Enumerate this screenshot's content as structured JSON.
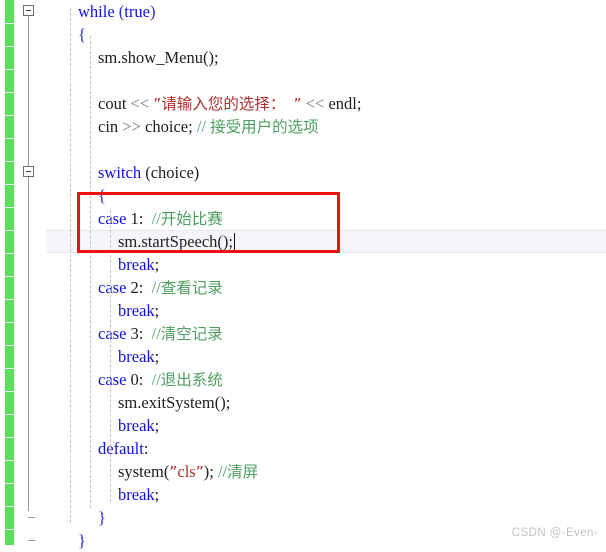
{
  "app": {
    "kind": "code-editor",
    "language": "C++",
    "theme_background": "#ffffff"
  },
  "colors": {
    "keyword": "#1111dd",
    "string": "#b03030",
    "comment": "#4d9f60",
    "operator": "#6a7a8c",
    "plain": "#202020",
    "change_bar": "#5ae05a",
    "annotation_rect": "#ee1111",
    "current_line": "#f6f6fa",
    "watermark": "#c2c2c2"
  },
  "gutter": {
    "fold_markers": [
      {
        "label": "-",
        "line": 1
      },
      {
        "label": "-",
        "line": 8
      }
    ],
    "change_bar_label": "modified-lines-indicator"
  },
  "annotation": {
    "shape": "rectangle",
    "color": "#ee1111",
    "covers_lines": "case 1: //开始比赛  /  sm.startSpeech();"
  },
  "caret": {
    "line": 11,
    "after_text": "sm.startSpeech();"
  },
  "watermark": {
    "text": "CSDN @-Even-"
  },
  "code": {
    "lines": [
      {
        "n": 1,
        "indent": 1,
        "tokens": [
          {
            "t": "while",
            "c": "kw"
          },
          {
            "t": " ",
            "c": "pln"
          },
          {
            "t": "(",
            "c": "brc"
          },
          {
            "t": "true",
            "c": "kw"
          },
          {
            "t": ")",
            "c": "brc"
          }
        ]
      },
      {
        "n": 2,
        "indent": 1,
        "tokens": [
          {
            "t": "{",
            "c": "brc"
          }
        ]
      },
      {
        "n": 3,
        "indent": 2,
        "tokens": [
          {
            "t": "sm.show_Menu();",
            "c": "pln"
          }
        ]
      },
      {
        "n": 4,
        "indent": 0,
        "tokens": []
      },
      {
        "n": 5,
        "indent": 2,
        "tokens": [
          {
            "t": "cout ",
            "c": "pln"
          },
          {
            "t": "<<",
            "c": "op"
          },
          {
            "t": " ",
            "c": "pln"
          },
          {
            "t": "”请输入您的选择：  ”",
            "c": "str"
          },
          {
            "t": " ",
            "c": "pln"
          },
          {
            "t": "<<",
            "c": "op"
          },
          {
            "t": " endl;",
            "c": "pln"
          }
        ]
      },
      {
        "n": 6,
        "indent": 2,
        "tokens": [
          {
            "t": "cin ",
            "c": "pln"
          },
          {
            "t": ">>",
            "c": "op"
          },
          {
            "t": " choice; ",
            "c": "pln"
          },
          {
            "t": "// 接受用户的选项",
            "c": "cmt"
          }
        ]
      },
      {
        "n": 7,
        "indent": 0,
        "tokens": []
      },
      {
        "n": 8,
        "indent": 2,
        "tokens": [
          {
            "t": "switch",
            "c": "kw"
          },
          {
            "t": " ",
            "c": "pln"
          },
          {
            "t": "(choice)",
            "c": "pln"
          }
        ]
      },
      {
        "n": 9,
        "indent": 2,
        "tokens": [
          {
            "t": "{",
            "c": "brc"
          }
        ]
      },
      {
        "n": 10,
        "indent": 2,
        "tokens": [
          {
            "t": "case",
            "c": "kw"
          },
          {
            "t": " 1:  ",
            "c": "pln"
          },
          {
            "t": "//开始比赛",
            "c": "cmt"
          }
        ]
      },
      {
        "n": 11,
        "indent": 3,
        "tokens": [
          {
            "t": "sm.startSpeech();",
            "c": "pln"
          }
        ],
        "caret": true,
        "current": true
      },
      {
        "n": 12,
        "indent": 3,
        "tokens": [
          {
            "t": "break",
            "c": "kw"
          },
          {
            "t": ";",
            "c": "pln"
          }
        ]
      },
      {
        "n": 13,
        "indent": 2,
        "tokens": [
          {
            "t": "case",
            "c": "kw"
          },
          {
            "t": " 2:  ",
            "c": "pln"
          },
          {
            "t": "//查看记录",
            "c": "cmt"
          }
        ]
      },
      {
        "n": 14,
        "indent": 3,
        "tokens": [
          {
            "t": "break",
            "c": "kw"
          },
          {
            "t": ";",
            "c": "pln"
          }
        ]
      },
      {
        "n": 15,
        "indent": 2,
        "tokens": [
          {
            "t": "case",
            "c": "kw"
          },
          {
            "t": " 3:  ",
            "c": "pln"
          },
          {
            "t": "//清空记录",
            "c": "cmt"
          }
        ]
      },
      {
        "n": 16,
        "indent": 3,
        "tokens": [
          {
            "t": "break",
            "c": "kw"
          },
          {
            "t": ";",
            "c": "pln"
          }
        ]
      },
      {
        "n": 17,
        "indent": 2,
        "tokens": [
          {
            "t": "case",
            "c": "kw"
          },
          {
            "t": " 0:  ",
            "c": "pln"
          },
          {
            "t": "//退出系统",
            "c": "cmt"
          }
        ]
      },
      {
        "n": 18,
        "indent": 3,
        "tokens": [
          {
            "t": "sm.exitSystem();",
            "c": "pln"
          }
        ]
      },
      {
        "n": 19,
        "indent": 3,
        "tokens": [
          {
            "t": "break",
            "c": "kw"
          },
          {
            "t": ";",
            "c": "pln"
          }
        ]
      },
      {
        "n": 20,
        "indent": 2,
        "tokens": [
          {
            "t": "default",
            "c": "kw"
          },
          {
            "t": ":",
            "c": "pln"
          }
        ]
      },
      {
        "n": 21,
        "indent": 3,
        "tokens": [
          {
            "t": "system(",
            "c": "pln"
          },
          {
            "t": "”cls”",
            "c": "str"
          },
          {
            "t": "); ",
            "c": "pln"
          },
          {
            "t": "//清屏",
            "c": "cmt"
          }
        ]
      },
      {
        "n": 22,
        "indent": 3,
        "tokens": [
          {
            "t": "break",
            "c": "kw"
          },
          {
            "t": ";",
            "c": "pln"
          }
        ]
      },
      {
        "n": 23,
        "indent": 2,
        "tokens": [
          {
            "t": "}",
            "c": "brc"
          }
        ]
      },
      {
        "n": 24,
        "indent": 1,
        "tokens": [
          {
            "t": "}",
            "c": "brc"
          }
        ]
      }
    ]
  }
}
